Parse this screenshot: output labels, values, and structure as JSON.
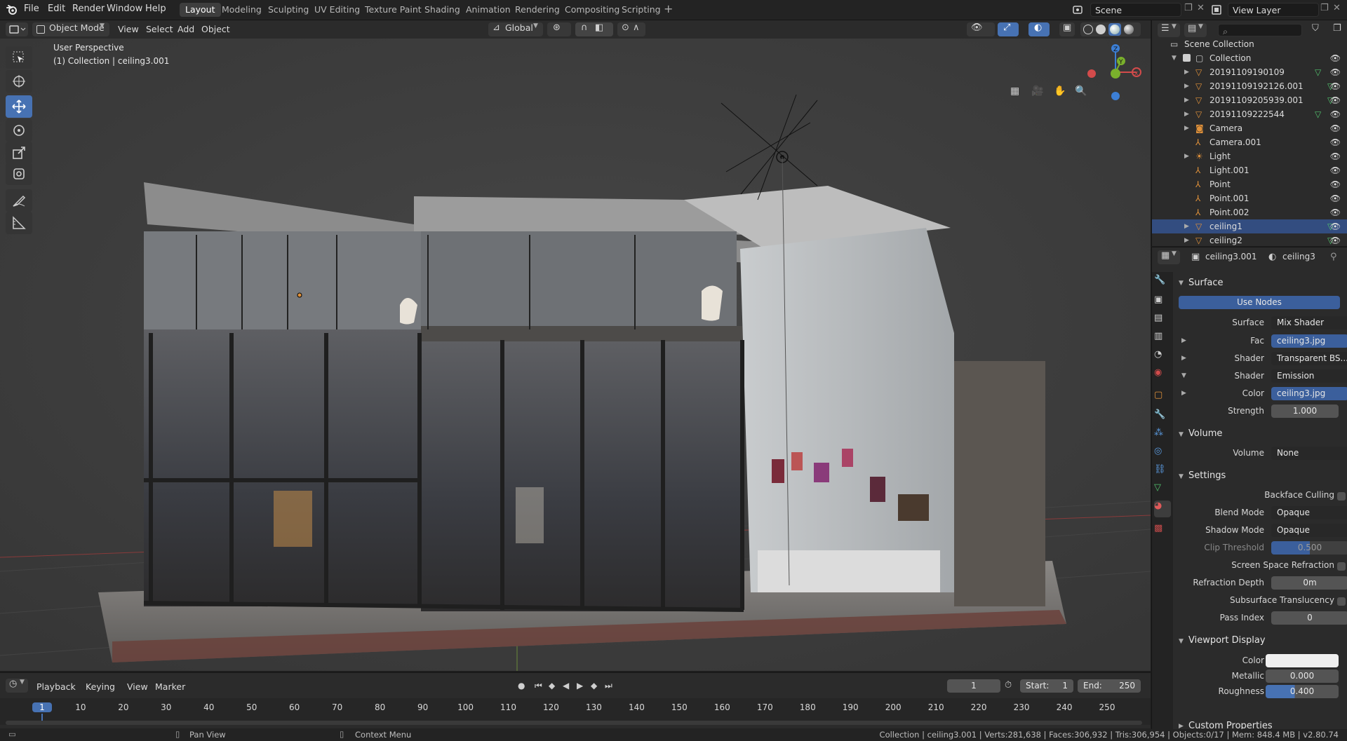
{
  "menu": {
    "items": [
      "File",
      "Edit",
      "Render",
      "Window",
      "Help"
    ]
  },
  "workspaces": [
    "Layout",
    "Modeling",
    "Sculpting",
    "UV Editing",
    "Texture Paint",
    "Shading",
    "Animation",
    "Rendering",
    "Compositing",
    "Scripting"
  ],
  "active_workspace": "Layout",
  "scene_name": "Scene",
  "view_layer": "View Layer",
  "viewport_header": {
    "mode": "Object Mode",
    "menus": [
      "View",
      "Select",
      "Add",
      "Object"
    ],
    "orientation": "Global"
  },
  "viewport": {
    "perspective_label": "User Perspective",
    "collection_label": "(1) Collection | ceiling3.001"
  },
  "outliner": {
    "root": "Scene Collection",
    "collection": "Collection",
    "items": [
      {
        "name": "20191109190109",
        "icon": "mesh-icon",
        "selected": false
      },
      {
        "name": "20191109192126.001",
        "icon": "mesh-icon",
        "selected": false
      },
      {
        "name": "20191109205939.001",
        "icon": "mesh-icon",
        "selected": false
      },
      {
        "name": "20191109222544",
        "icon": "mesh-icon",
        "selected": false
      },
      {
        "name": "Camera",
        "icon": "camera-icon",
        "selected": false
      },
      {
        "name": "Camera.001",
        "icon": "empty-icon",
        "selected": false
      },
      {
        "name": "Light",
        "icon": "light-icon",
        "selected": false
      },
      {
        "name": "Light.001",
        "icon": "empty-icon",
        "selected": false
      },
      {
        "name": "Point",
        "icon": "empty-icon",
        "selected": false
      },
      {
        "name": "Point.001",
        "icon": "empty-icon",
        "selected": false
      },
      {
        "name": "Point.002",
        "icon": "empty-icon",
        "selected": false
      },
      {
        "name": "ceiling1",
        "icon": "mesh-icon",
        "selected": true
      },
      {
        "name": "ceiling2",
        "icon": "mesh-icon",
        "selected": false
      }
    ]
  },
  "properties": {
    "object_name": "ceiling3.001",
    "material_name": "ceiling3",
    "surface": {
      "title": "Surface",
      "use_nodes": "Use Nodes",
      "rows": [
        {
          "label": "Surface",
          "value": "Mix Shader"
        },
        {
          "label": "Fac",
          "value": "ceiling3.jpg"
        },
        {
          "label": "Shader",
          "value": "Transparent BS..."
        },
        {
          "label": "Shader",
          "value": "Emission"
        },
        {
          "label": "Color",
          "value": "ceiling3.jpg"
        },
        {
          "label": "Strength",
          "value": "1.000"
        }
      ]
    },
    "volume": {
      "title": "Volume",
      "label": "Volume",
      "value": "None"
    },
    "settings": {
      "title": "Settings",
      "backface_culling": "Backface Culling",
      "blend_mode_label": "Blend Mode",
      "blend_mode": "Opaque",
      "shadow_mode_label": "Shadow Mode",
      "shadow_mode": "Opaque",
      "clip_threshold_label": "Clip Threshold",
      "clip_threshold": "0.500",
      "ssr_label": "Screen Space Refraction",
      "refraction_depth_label": "Refraction Depth",
      "refraction_depth": "0m",
      "subsurface_label": "Subsurface Translucency",
      "pass_index_label": "Pass Index",
      "pass_index": "0"
    },
    "viewport_display": {
      "title": "Viewport Display",
      "color_label": "Color",
      "metallic_label": "Metallic",
      "metallic": "0.000",
      "roughness_label": "Roughness",
      "roughness": "0.400",
      "roughness_value": 0.4
    },
    "custom_properties": "Custom Properties"
  },
  "timeline": {
    "menus": [
      "Playback",
      "Keying",
      "View",
      "Marker"
    ],
    "current_frame": "1",
    "start_label": "Start:",
    "start": "1",
    "end_label": "End:",
    "end": "250",
    "ticks": [
      "1",
      "10",
      "20",
      "30",
      "40",
      "50",
      "60",
      "70",
      "80",
      "90",
      "100",
      "110",
      "120",
      "130",
      "140",
      "150",
      "160",
      "170",
      "180",
      "190",
      "200",
      "210",
      "220",
      "230",
      "240",
      "250"
    ]
  },
  "statusbar": {
    "pan_view": "Pan View",
    "context_menu": "Context Menu",
    "stats": "Collection | ceiling3.001 | Verts:281,638 | Faces:306,932 | Tris:306,954 | Objects:0/17 | Mem: 848.4 MB | v2.80.74"
  },
  "colors": {
    "accent": "#4772b3",
    "selection": "#334d80",
    "mesh": "#e0913a"
  }
}
